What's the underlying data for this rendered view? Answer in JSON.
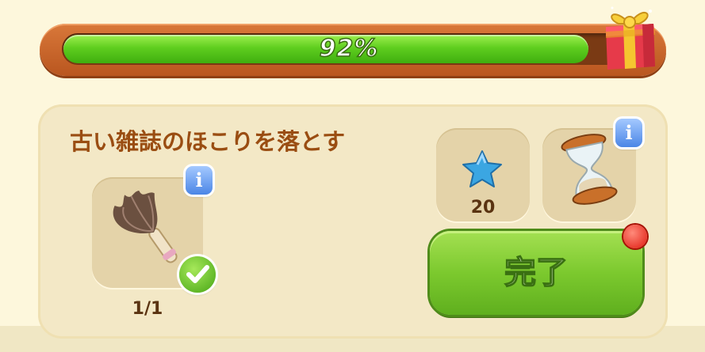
{
  "progress": {
    "label": "92%",
    "fraction": 0.92,
    "fill_color": "#5fce1f"
  },
  "gift_icon": "gift-box-icon",
  "quest": {
    "title": "古い雑誌のほこりを落とす",
    "item_icon": "feather-duster-icon",
    "item_count": "1/1",
    "item_completed": true
  },
  "rewards": {
    "star_icon": "blue-star-icon",
    "star_amount": "20",
    "time_icon": "hourglass-icon"
  },
  "info_label": "i",
  "complete_button": {
    "label": "完了",
    "color": "#7cc92e"
  },
  "notification": true
}
